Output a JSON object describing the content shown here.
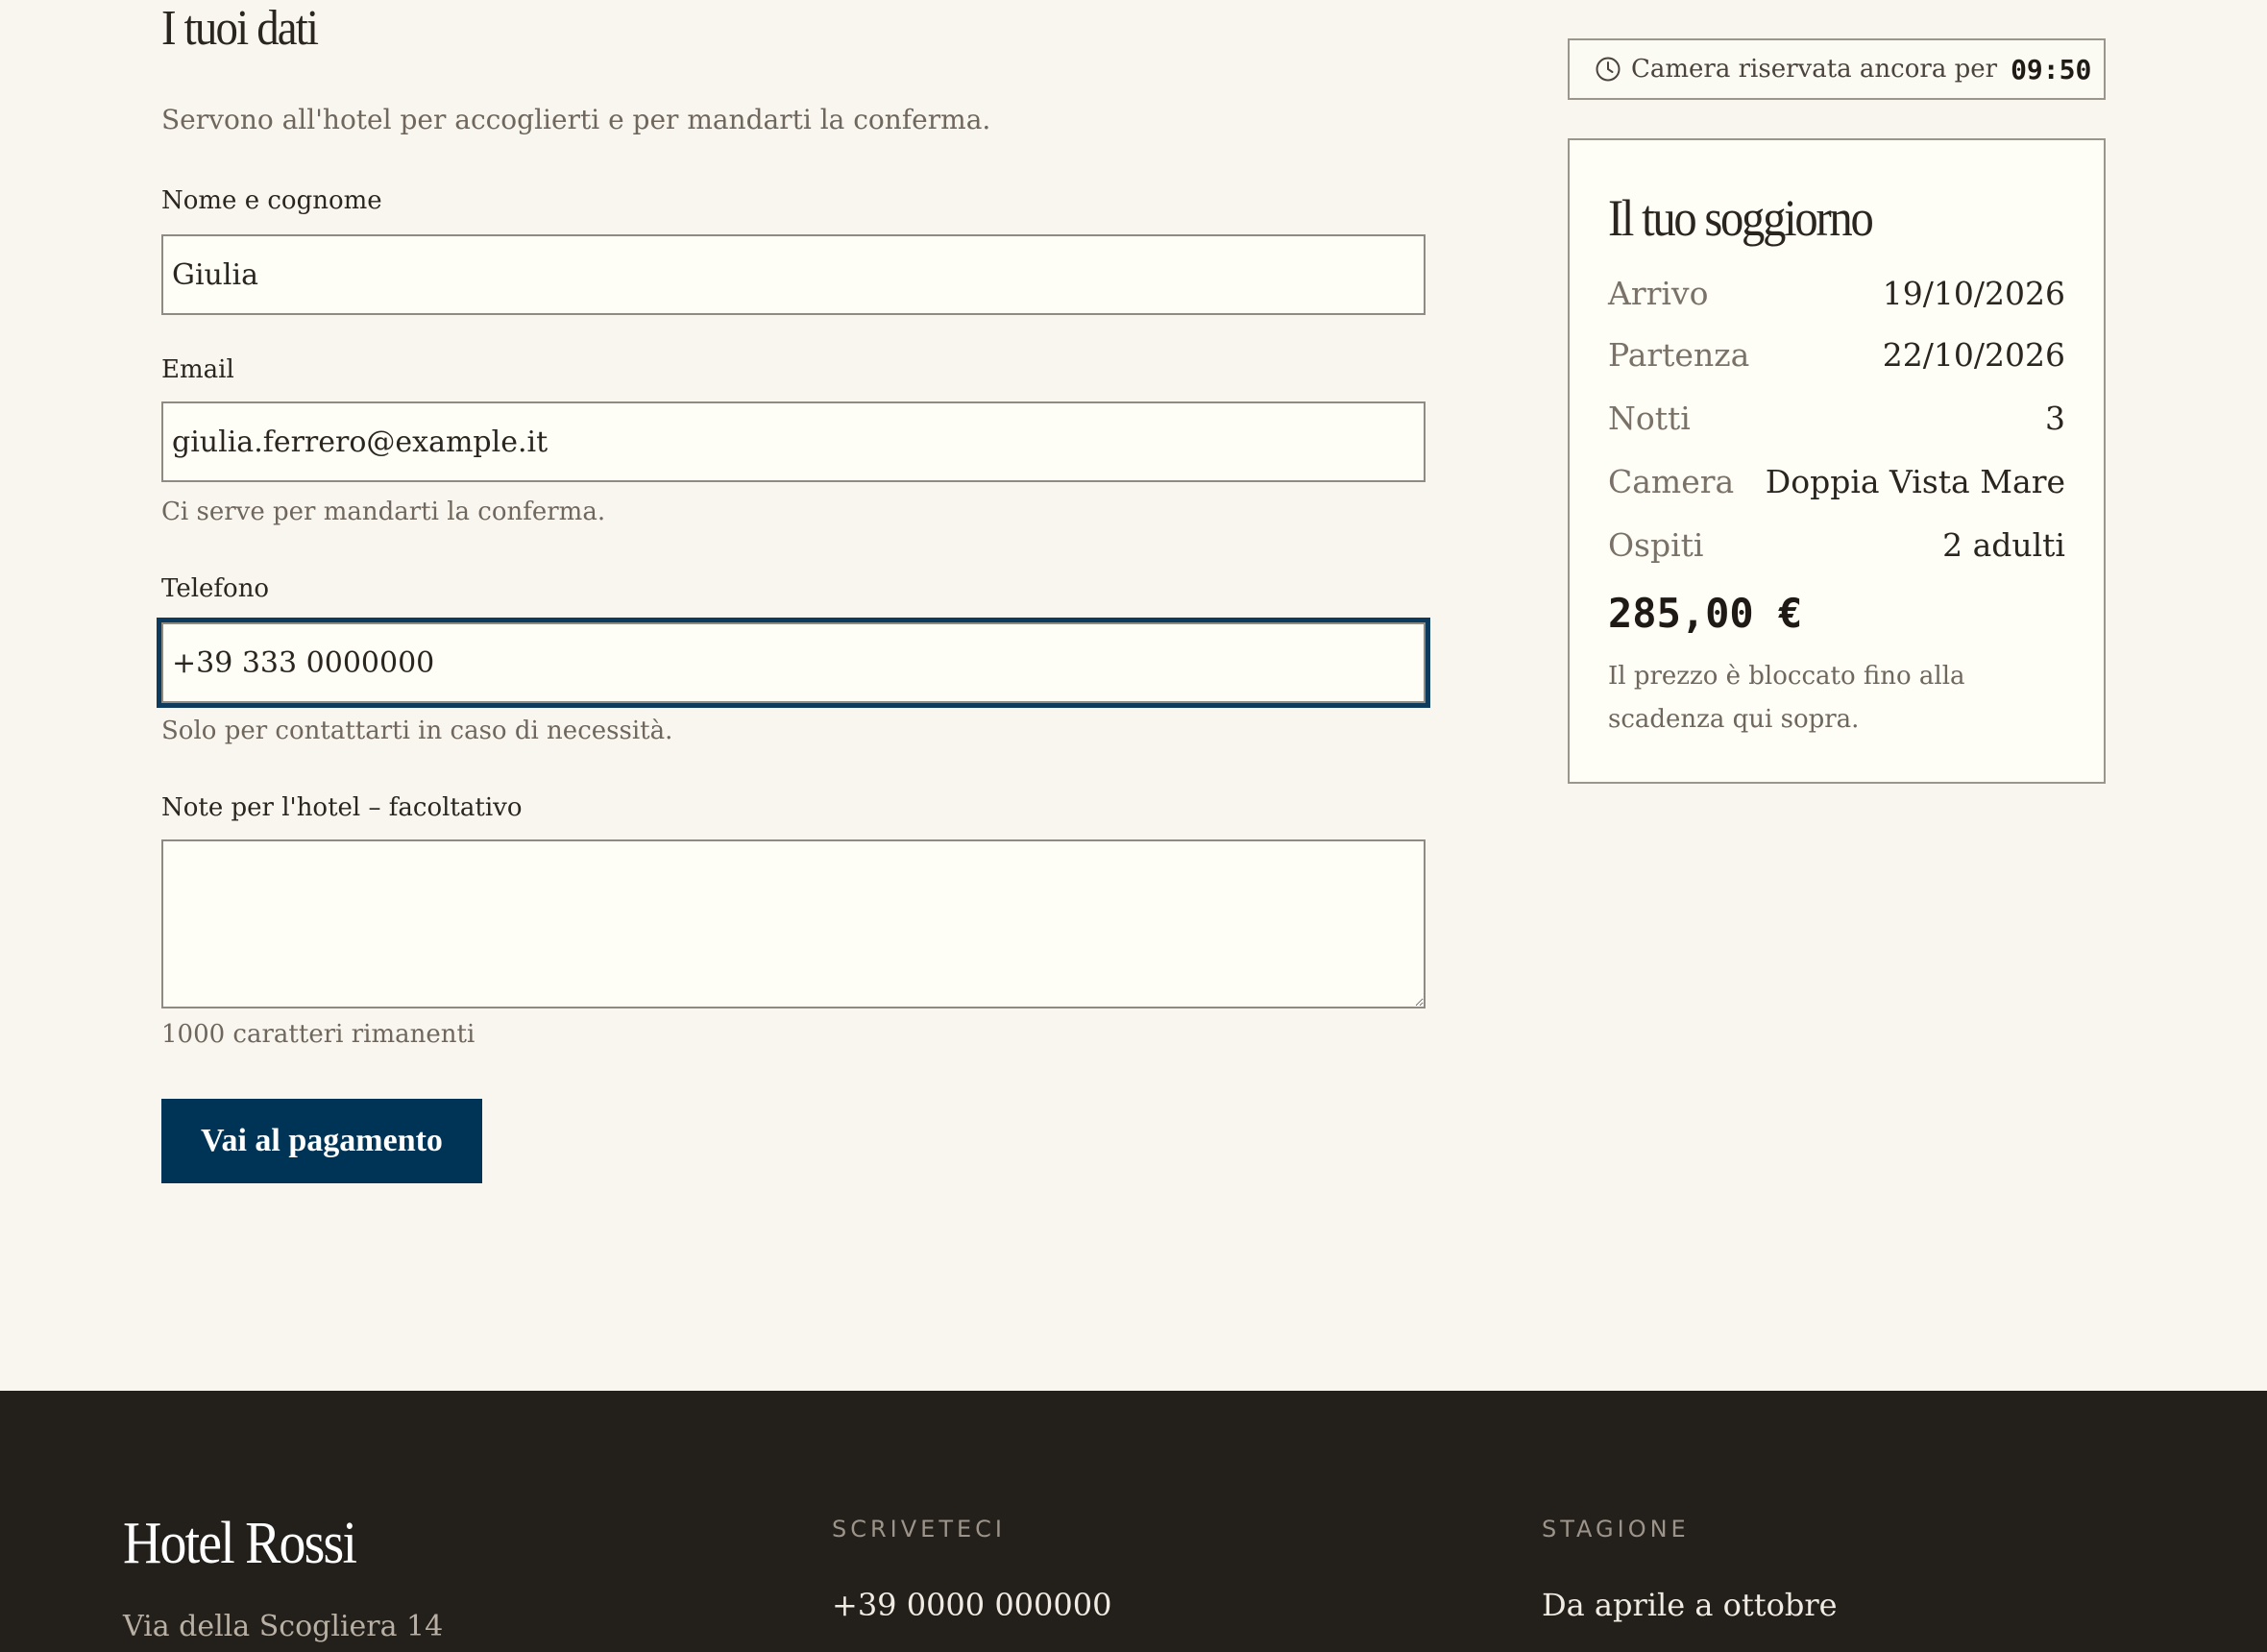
{
  "form": {
    "title": "I tuoi dati",
    "subtitle": "Servono all'hotel per accoglierti e per mandarti la conferma.",
    "name": {
      "label": "Nome e cognome",
      "value": "Giulia"
    },
    "email": {
      "label": "Email",
      "value": "giulia.ferrero@example.it",
      "hint": "Ci serve per mandarti la conferma."
    },
    "phone": {
      "label": "Telefono",
      "value": "+39 333 0000000",
      "hint": "Solo per contattarti in caso di necessità."
    },
    "notes": {
      "label": "Note per l'hotel – facoltativo",
      "value": "",
      "counter": "1000 caratteri rimanenti"
    },
    "submit_label": "Vai al pagamento"
  },
  "timer": {
    "text": "Camera riservata ancora per",
    "time": "09:50",
    "icon": "clock-icon"
  },
  "summary": {
    "title": "Il tuo soggiorno",
    "rows": [
      {
        "key": "Arrivo",
        "value": "19/10/2026"
      },
      {
        "key": "Partenza",
        "value": "22/10/2026"
      },
      {
        "key": "Notti",
        "value": "3"
      },
      {
        "key": "Camera",
        "value": "Doppia Vista Mare"
      },
      {
        "key": "Ospiti",
        "value": "2 adulti"
      }
    ],
    "price": "285,00 €",
    "price_note": "Il prezzo è bloccato fino alla scadenza qui sopra."
  },
  "footer": {
    "brand": "Hotel Rossi",
    "address": "Via della Scogliera 14",
    "contact_title": "SCRIVETECI",
    "contact_value": "+39 0000 000000",
    "season_title": "STAGIONE",
    "season_value": "Da aprile a ottobre"
  },
  "colors": {
    "background": "#f9f6f0",
    "accent": "#003457",
    "footer_bg": "#231f1a"
  }
}
